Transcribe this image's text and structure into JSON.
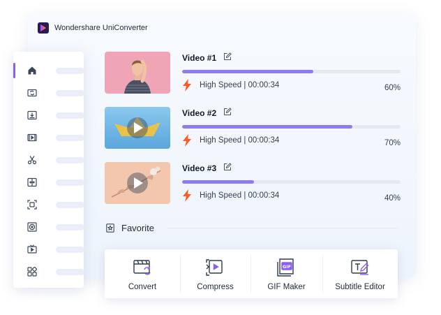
{
  "app": {
    "title": "Wondershare UniConverter"
  },
  "sidebar": {
    "items": [
      {
        "icon": "home-icon",
        "active": true
      },
      {
        "icon": "convert-icon",
        "active": false
      },
      {
        "icon": "download-icon",
        "active": false
      },
      {
        "icon": "video-player-icon",
        "active": false
      },
      {
        "icon": "scissors-icon",
        "active": false
      },
      {
        "icon": "merge-icon",
        "active": false
      },
      {
        "icon": "screen-record-icon",
        "active": false
      },
      {
        "icon": "dvd-burn-icon",
        "active": false
      },
      {
        "icon": "tv-icon",
        "active": false
      },
      {
        "icon": "toolbox-icon",
        "active": false
      }
    ]
  },
  "videos": [
    {
      "title": "Video #1",
      "speed": "High Speed",
      "time": "00:00:34",
      "separator": "|",
      "percent_label": "60%",
      "progress": 0.6,
      "thumbnail": "man-portrait"
    },
    {
      "title": "Video #2",
      "speed": "High Speed",
      "time": "00:00:34",
      "separator": "|",
      "percent_label": "70%",
      "progress": 0.78,
      "thumbnail": "paper-boat"
    },
    {
      "title": "Video #3",
      "speed": "High Speed",
      "time": "00:00:34",
      "separator": "|",
      "percent_label": "40%",
      "progress": 0.33,
      "thumbnail": "dried-flowers"
    }
  ],
  "favorite": {
    "label": "Favorite"
  },
  "tools": [
    {
      "label": "Convert",
      "icon": "convert-tool-icon"
    },
    {
      "label": "Compress",
      "icon": "compress-tool-icon"
    },
    {
      "label": "GIF Maker",
      "icon": "gif-maker-icon",
      "badge": "GIF"
    },
    {
      "label": "Subtitle Editor",
      "icon": "subtitle-editor-icon"
    }
  ],
  "colors": {
    "accent": "#8b5cf6",
    "progress": "#8b7cf0",
    "bolt": "#ff5a1f",
    "icon": "#3c4658"
  }
}
